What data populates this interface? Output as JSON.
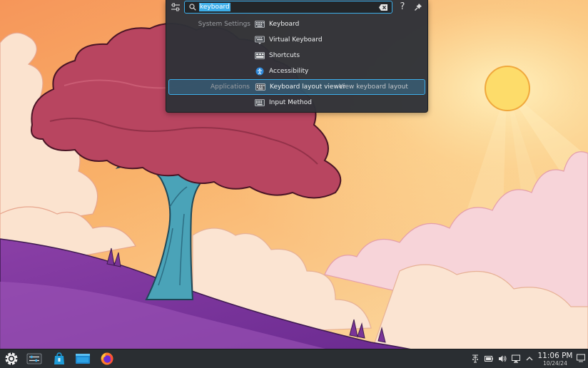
{
  "krunner": {
    "query": "keyboard",
    "help_glyph": "?",
    "results": [
      {
        "category": "System Settings",
        "title": "Keyboard",
        "subtitle": "",
        "icon": "keyboard-icon"
      },
      {
        "category": "",
        "title": "Virtual Keyboard",
        "subtitle": "",
        "icon": "virtual-keyboard-icon"
      },
      {
        "category": "",
        "title": "Shortcuts",
        "subtitle": "",
        "icon": "shortcuts-icon"
      },
      {
        "category": "",
        "title": "Accessibility",
        "subtitle": "",
        "icon": "accessibility-icon"
      },
      {
        "category": "Applications",
        "title": "Keyboard layout viewer",
        "subtitle": "View keyboard layout",
        "icon": "keyboard-layout-icon"
      },
      {
        "category": "",
        "title": "Input Method",
        "subtitle": "",
        "icon": "input-method-icon"
      }
    ]
  },
  "panel": {
    "launchers": [
      "app-launcher-icon",
      "system-settings-icon",
      "discover-store-icon",
      "dolphin-file-manager-icon",
      "firefox-icon"
    ],
    "tray": [
      "network-icon",
      "battery-icon",
      "volume-icon",
      "display-icon",
      "tray-expand-icon"
    ],
    "clock": {
      "time": "11:06 PM",
      "date": "10/24/24"
    }
  },
  "colors": {
    "accent": "#3daee9",
    "krunner_bg": "#303238",
    "panel_bg": "#2a2e32"
  }
}
